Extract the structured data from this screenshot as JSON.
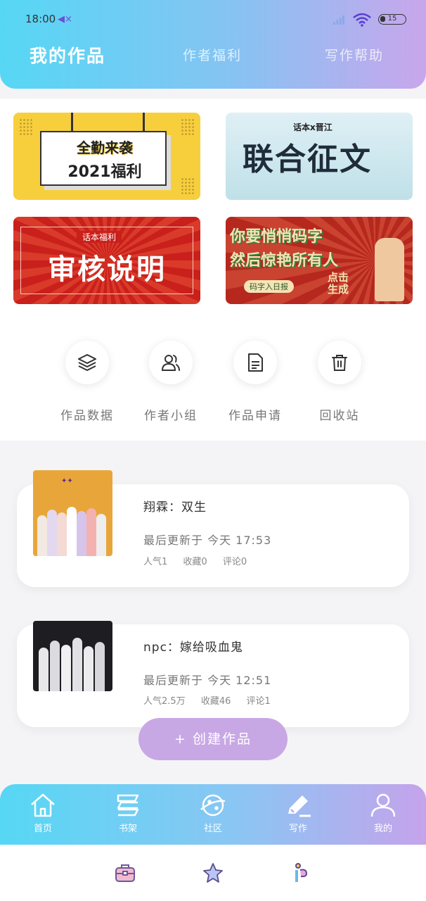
{
  "status": {
    "time": "18:00",
    "battery": "15"
  },
  "tabs": [
    {
      "label": "我的作品",
      "active": true
    },
    {
      "label": "作者福利",
      "active": false
    },
    {
      "label": "写作帮助",
      "active": false
    }
  ],
  "banners": {
    "b1": {
      "line1": "全勤来袭",
      "line2": "2021福利"
    },
    "b2": {
      "top": "话本x晋江",
      "big": "联合征文"
    },
    "b3": {
      "small": "话本福利",
      "big": "审核说明"
    },
    "b4": {
      "line1": "你要悄悄码字",
      "line2": "然后惊艳所有人",
      "pill": "码字入日报",
      "click": "点击生成"
    }
  },
  "quick": [
    {
      "label": "作品数据",
      "icon": "layers-icon"
    },
    {
      "label": "作者小组",
      "icon": "group-icon"
    },
    {
      "label": "作品申请",
      "icon": "document-icon"
    },
    {
      "label": "回收站",
      "icon": "trash-icon"
    }
  ],
  "works": [
    {
      "title": "翔霖：双生",
      "update": "最后更新于 今天 17:53",
      "popularity": "人气1",
      "favorites": "收藏0",
      "comments": "评论0"
    },
    {
      "title": "npc：嫁给吸血鬼",
      "update": "最后更新于 今天 12:51",
      "popularity": "人气2.5万",
      "favorites": "收藏46",
      "comments": "评论1"
    }
  ],
  "create_button": "+ 创建作品",
  "nav": [
    {
      "label": "首页",
      "icon": "home-icon"
    },
    {
      "label": "书架",
      "icon": "bookshelf-icon"
    },
    {
      "label": "社区",
      "icon": "planet-icon"
    },
    {
      "label": "写作",
      "icon": "pen-icon"
    },
    {
      "label": "我的",
      "icon": "user-icon"
    }
  ],
  "colors": {
    "accent_start": "#56d7f4",
    "accent_end": "#c9a6ec",
    "create_button": "#c8a8e4"
  }
}
